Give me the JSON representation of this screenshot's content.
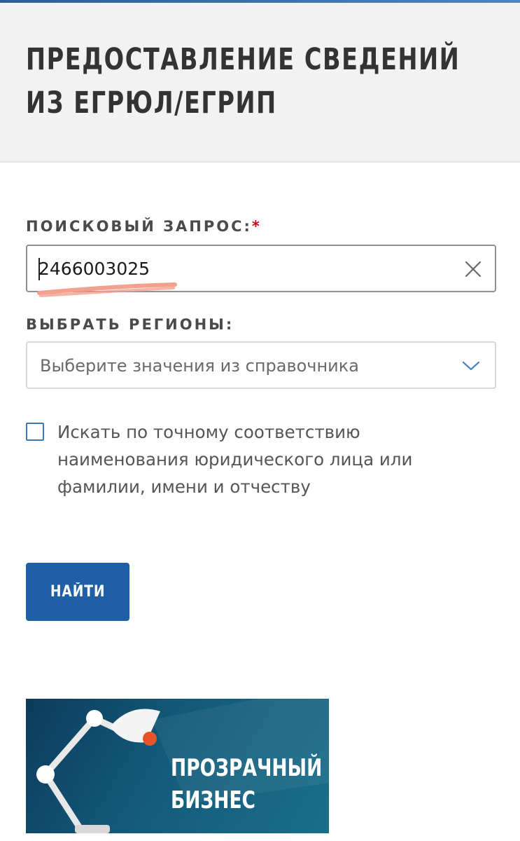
{
  "header": {
    "title_line1": "ПРЕДОСТАВЛЕНИЕ СВЕДЕНИЙ",
    "title_line2": "ИЗ ЕГРЮЛ/ЕГРИП"
  },
  "search": {
    "label": "ПОИСКОВЫЙ ЗАПРОС:",
    "required_mark": "*",
    "value": "2466003025"
  },
  "regions": {
    "label": "ВЫБРАТЬ РЕГИОНЫ:",
    "placeholder": "Выберите значения из справочника"
  },
  "exact_match": {
    "label": "Искать по точному соответствию наименования юридического лица или фамилии, имени и отчеству",
    "checked": false
  },
  "submit": {
    "label": "НАЙТИ"
  },
  "banner": {
    "line1": "ПРОЗРАЧНЫЙ",
    "line2": "БИЗНЕС"
  },
  "colors": {
    "accent": "#1e5fa6",
    "required": "#d0021b",
    "highlight_mark": "#f4a08e"
  }
}
